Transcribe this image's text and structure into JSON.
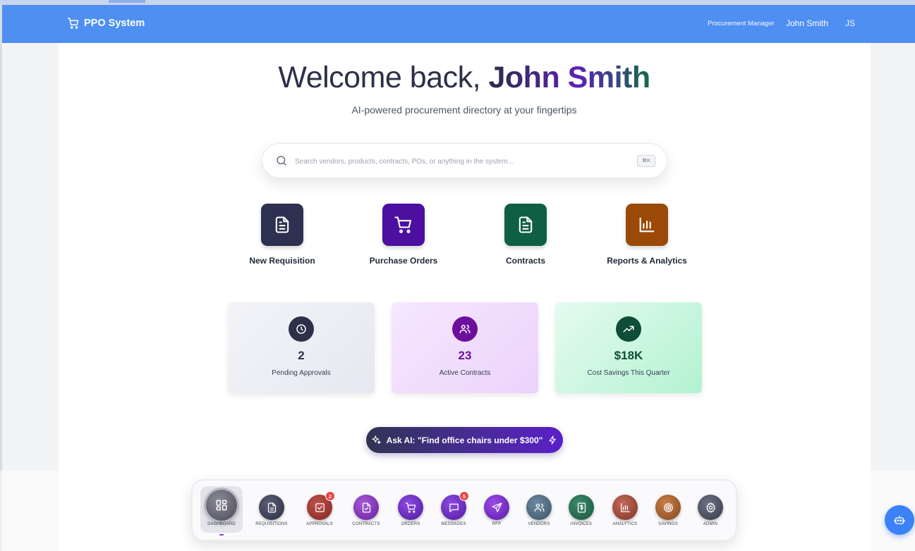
{
  "header": {
    "brand": "PPO System",
    "role": "Procurement Manager",
    "user_name": "John Smith",
    "user_initials": "JS"
  },
  "hero": {
    "greeting": "Welcome back, ",
    "name": "John Smith",
    "subtitle": "AI-powered procurement directory at your fingertips"
  },
  "search": {
    "placeholder": "Search vendors, products, contracts, POs, or anything in the system...",
    "shortcut": "⌘K"
  },
  "quick_actions": [
    {
      "label": "New Requisition",
      "icon": "document-icon",
      "color": "#2d3050"
    },
    {
      "label": "Purchase Orders",
      "icon": "cart-icon",
      "color": "#4c0fa0"
    },
    {
      "label": "Contracts",
      "icon": "document-icon",
      "color": "#0f5f44"
    },
    {
      "label": "Reports & Analytics",
      "icon": "bar-chart-icon",
      "color": "#9a4a06"
    }
  ],
  "stats": [
    {
      "value": "2",
      "label": "Pending Approvals",
      "icon": "clock-icon",
      "accent": "#2d3048"
    },
    {
      "value": "23",
      "label": "Active Contracts",
      "icon": "users-icon",
      "accent": "#6d0f9e"
    },
    {
      "value": "$18K",
      "label": "Cost Savings This Quarter",
      "icon": "trending-up-icon",
      "accent": "#0f4d38"
    }
  ],
  "ask_ai": {
    "label": "Ask AI: \"Find office chairs under $300\""
  },
  "dock": [
    {
      "label": "DASHBOARD",
      "icon": "dashboard-icon",
      "active": true
    },
    {
      "label": "REQUISITIONS",
      "icon": "document-icon"
    },
    {
      "label": "APPROVALS",
      "icon": "check-square-icon",
      "badge": "2"
    },
    {
      "label": "CONTRACTS",
      "icon": "file-check-icon"
    },
    {
      "label": "ORDERS",
      "icon": "cart-icon"
    },
    {
      "label": "MESSAGES",
      "icon": "message-icon",
      "badge": "5"
    },
    {
      "label": "RFP",
      "icon": "send-icon"
    },
    {
      "label": "VENDORS",
      "icon": "users-icon"
    },
    {
      "label": "INVOICES",
      "icon": "invoice-icon"
    },
    {
      "label": "ANALYTICS",
      "icon": "bar-chart-icon"
    },
    {
      "label": "SAVINGS",
      "icon": "target-icon"
    },
    {
      "label": "ADMIN",
      "icon": "gear-icon"
    }
  ],
  "colors": {
    "header": "#4f8ff2",
    "fab": "#3b82f6",
    "badge": "#ef4444"
  }
}
